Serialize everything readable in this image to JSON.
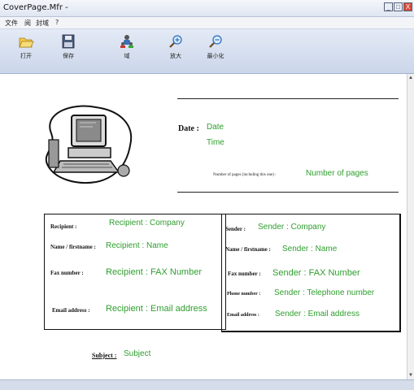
{
  "window": {
    "title": "CoverPage.Mfr -",
    "controls": [
      "_",
      "□",
      "X"
    ]
  },
  "menu": {
    "items": [
      "文件",
      "阅",
      "封域",
      "?"
    ]
  },
  "toolbar": {
    "buttons": [
      {
        "label": "打开",
        "icon": "folder-open-icon"
      },
      {
        "label": "保存",
        "icon": "floppy-save-icon"
      },
      {
        "label": "域",
        "icon": "people-field-icon"
      },
      {
        "label": "放大",
        "icon": "zoom-in-icon"
      },
      {
        "label": "最小化",
        "icon": "zoom-out-icon"
      }
    ]
  },
  "cover": {
    "date_label": "Date :",
    "date_value": "Date",
    "time_value": "Time",
    "pages_label": "Number of pages (including this one) :",
    "pages_value": "Number of pages",
    "recipient": {
      "label": "Recipient :",
      "value": "Recipient : Company",
      "name_label": "Name / firstname :",
      "name_value": "Recipient : Name",
      "fax_label": "Fax number :",
      "fax_value": "Recipient : FAX Number",
      "email_label": "Email address :",
      "email_value": "Recipient : Email address"
    },
    "sender": {
      "label": "Sender :",
      "value": "Sender : Company",
      "name_label": "Name / firstname :",
      "name_value": "Sender : Name",
      "fax_label": "Fax number :",
      "fax_value": "Sender : FAX Number",
      "phone_label": "Phone number :",
      "phone_value": "Sender : Telephone number",
      "email_label": "Email address :",
      "email_value": "Sender : Email address"
    },
    "subject_label": "Subject :",
    "subject_value": "Subject"
  },
  "colors": {
    "field_text": "#2e9e2e",
    "toolbar_bg": "#cbd6ea"
  }
}
